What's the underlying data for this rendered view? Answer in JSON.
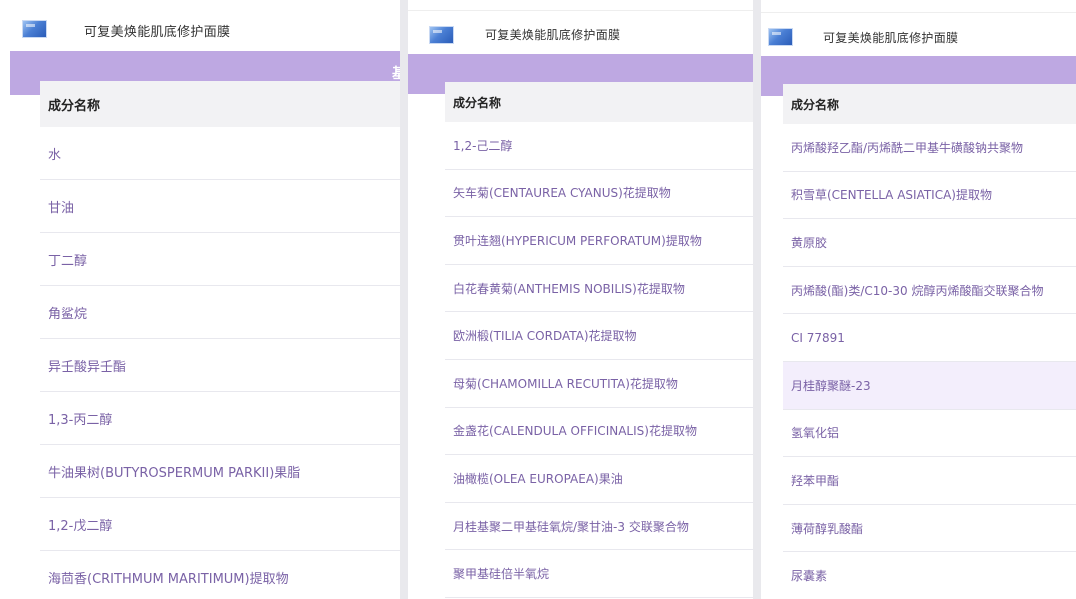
{
  "product_title": "可复美焕能肌底修护面膜",
  "band_label": "基",
  "column_header": "成分名称",
  "panel1": {
    "rows": [
      "水",
      "甘油",
      "丁二醇",
      "角鲨烷",
      "异壬酸异壬酯",
      "1,3-丙二醇",
      "牛油果树(BUTYROSPERMUM PARKII)果脂",
      "1,2-戊二醇",
      "海茴香(CRITHMUM MARITIMUM)提取物"
    ]
  },
  "panel2": {
    "rows": [
      "1,2-己二醇",
      "矢车菊(CENTAUREA CYANUS)花提取物",
      "贯叶连翘(HYPERICUM PERFORATUM)提取物",
      "白花春黄菊(ANTHEMIS NOBILIS)花提取物",
      "欧洲椴(TILIA CORDATA)花提取物",
      "母菊(CHAMOMILLA RECUTITA)花提取物",
      "金盏花(CALENDULA OFFICINALIS)花提取物",
      "油橄榄(OLEA EUROPAEA)果油",
      "月桂基聚二甲基硅氧烷/聚甘油-3 交联聚合物",
      "聚甲基硅倍半氧烷"
    ]
  },
  "panel3": {
    "rows": [
      "丙烯酸羟乙酯/丙烯酰二甲基牛磺酸钠共聚物",
      "积雪草(CENTELLA ASIATICA)提取物",
      "黄原胶",
      "丙烯酸(酯)类/C10-30 烷醇丙烯酸酯交联聚合物",
      "CI 77891",
      "月桂醇聚醚-23",
      "氢氧化铝",
      "羟苯甲酯",
      "薄荷醇乳酸酯",
      "尿囊素"
    ],
    "highlighted_row": "月桂醇聚醚-23"
  },
  "colors": {
    "accent_band": "#bea8e2",
    "ingredient_text": "#7a62a6",
    "header_bg": "#f2f2f4",
    "highlight_bg": "#f3eefc"
  },
  "icons": [
    "product-logo-icon"
  ]
}
